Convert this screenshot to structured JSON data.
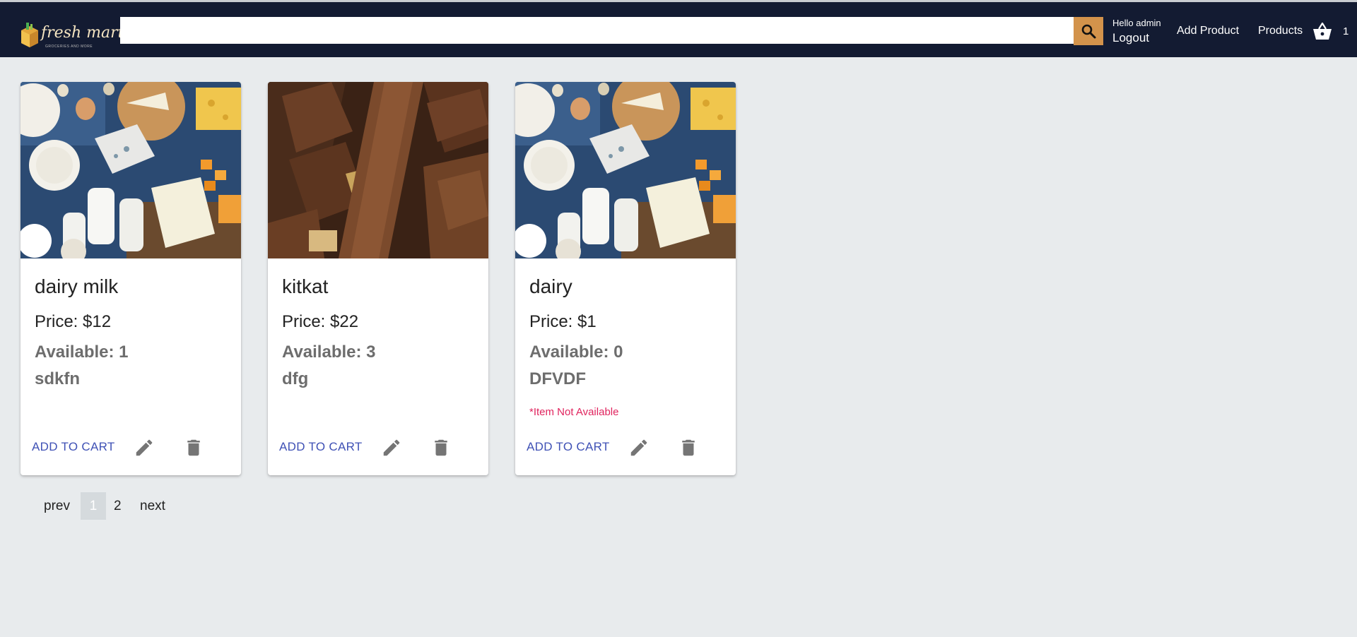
{
  "header": {
    "logo_text": "fresh mart",
    "logo_subtitle": "GROCERIES AND MORE",
    "search": {
      "value": "",
      "placeholder": ""
    },
    "search_icon": "search-icon",
    "greeting": "Hello admin",
    "logout_label": "Logout",
    "add_product_label": "Add Product",
    "products_label": "Products",
    "cart_icon": "basket-icon",
    "cart_count": "1"
  },
  "colors": {
    "navbar": "#131b32",
    "search_button": "#d3934b",
    "accent": "#3f51b5",
    "warning": "#e0245e"
  },
  "products": [
    {
      "title": "dairy milk",
      "price": "Price: $12",
      "available": "Available: 1",
      "description": "sdkfn",
      "warning": "",
      "image": "dairy-products-photo",
      "add_to_cart_label": "ADD TO CART"
    },
    {
      "title": "kitkat",
      "price": "Price: $22",
      "available": "Available: 3",
      "description": "dfg",
      "warning": "",
      "image": "chocolate-bars-photo",
      "add_to_cart_label": "ADD TO CART"
    },
    {
      "title": "dairy",
      "price": "Price: $1",
      "available": "Available: 0",
      "description": "DFVDF",
      "warning": "*Item Not Available",
      "image": "dairy-products-photo",
      "add_to_cart_label": "ADD TO CART"
    }
  ],
  "pagination": {
    "prev_label": "prev",
    "pages": [
      "1",
      "2"
    ],
    "current_page": "1",
    "next_label": "next"
  }
}
